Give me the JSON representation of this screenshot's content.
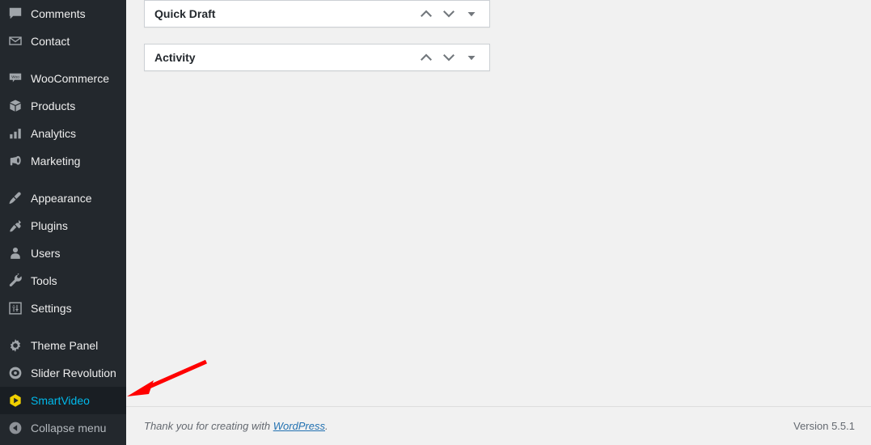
{
  "colors": {
    "sidebar_bg": "#23282d",
    "sidebar_active_bg": "#191e23",
    "sidebar_text": "#eeeeee",
    "sidebar_icon": "#a0a5aa",
    "active_text": "#00b9eb",
    "smartvideo_icon": "#f0d000",
    "content_bg": "#f1f1f1",
    "panel_bg": "#ffffff",
    "panel_border": "#ccd0d4",
    "link": "#2271b1",
    "annotation_arrow": "#ff0000"
  },
  "sidebar": {
    "items": [
      {
        "label": "Comments",
        "icon": "comment-icon",
        "active": false,
        "dim": false,
        "group_start": false
      },
      {
        "label": "Contact",
        "icon": "envelope-icon",
        "active": false,
        "dim": false,
        "group_start": false
      },
      {
        "label": "WooCommerce",
        "icon": "woocommerce-icon",
        "active": false,
        "dim": false,
        "group_start": true
      },
      {
        "label": "Products",
        "icon": "box-icon",
        "active": false,
        "dim": false,
        "group_start": false
      },
      {
        "label": "Analytics",
        "icon": "bar-chart-icon",
        "active": false,
        "dim": false,
        "group_start": false
      },
      {
        "label": "Marketing",
        "icon": "megaphone-icon",
        "active": false,
        "dim": false,
        "group_start": false
      },
      {
        "label": "Appearance",
        "icon": "paintbrush-icon",
        "active": false,
        "dim": false,
        "group_start": true
      },
      {
        "label": "Plugins",
        "icon": "plug-icon",
        "active": false,
        "dim": false,
        "group_start": false
      },
      {
        "label": "Users",
        "icon": "user-icon",
        "active": false,
        "dim": false,
        "group_start": false
      },
      {
        "label": "Tools",
        "icon": "wrench-icon",
        "active": false,
        "dim": false,
        "group_start": false
      },
      {
        "label": "Settings",
        "icon": "sliders-icon",
        "active": false,
        "dim": false,
        "group_start": false
      },
      {
        "label": "Theme Panel",
        "icon": "gear-icon",
        "active": false,
        "dim": false,
        "group_start": true
      },
      {
        "label": "Slider Revolution",
        "icon": "slider-revolution-icon",
        "active": false,
        "dim": false,
        "group_start": false
      },
      {
        "label": "SmartVideo",
        "icon": "smartvideo-play-icon",
        "active": true,
        "dim": false,
        "group_start": false
      },
      {
        "label": "Collapse menu",
        "icon": "collapse-arrow-icon",
        "active": false,
        "dim": true,
        "group_start": false
      }
    ]
  },
  "main": {
    "panels": [
      {
        "title": "Quick Draft",
        "actions": [
          {
            "name": "move-up-button",
            "icon": "chevron-up-icon"
          },
          {
            "name": "move-down-button",
            "icon": "chevron-down-icon"
          },
          {
            "name": "toggle-panel-button",
            "icon": "triangle-down-icon"
          }
        ]
      },
      {
        "title": "Activity",
        "actions": [
          {
            "name": "move-up-button",
            "icon": "chevron-up-icon"
          },
          {
            "name": "move-down-button",
            "icon": "chevron-down-icon"
          },
          {
            "name": "toggle-panel-button",
            "icon": "triangle-down-icon"
          }
        ]
      }
    ]
  },
  "footer": {
    "thanks_prefix": "Thank you for creating with ",
    "thanks_link": "WordPress",
    "thanks_suffix": ".",
    "version": "Version 5.5.1"
  },
  "annotation": {
    "type": "arrow",
    "points_to": "SmartVideo",
    "color": "#ff0000"
  }
}
